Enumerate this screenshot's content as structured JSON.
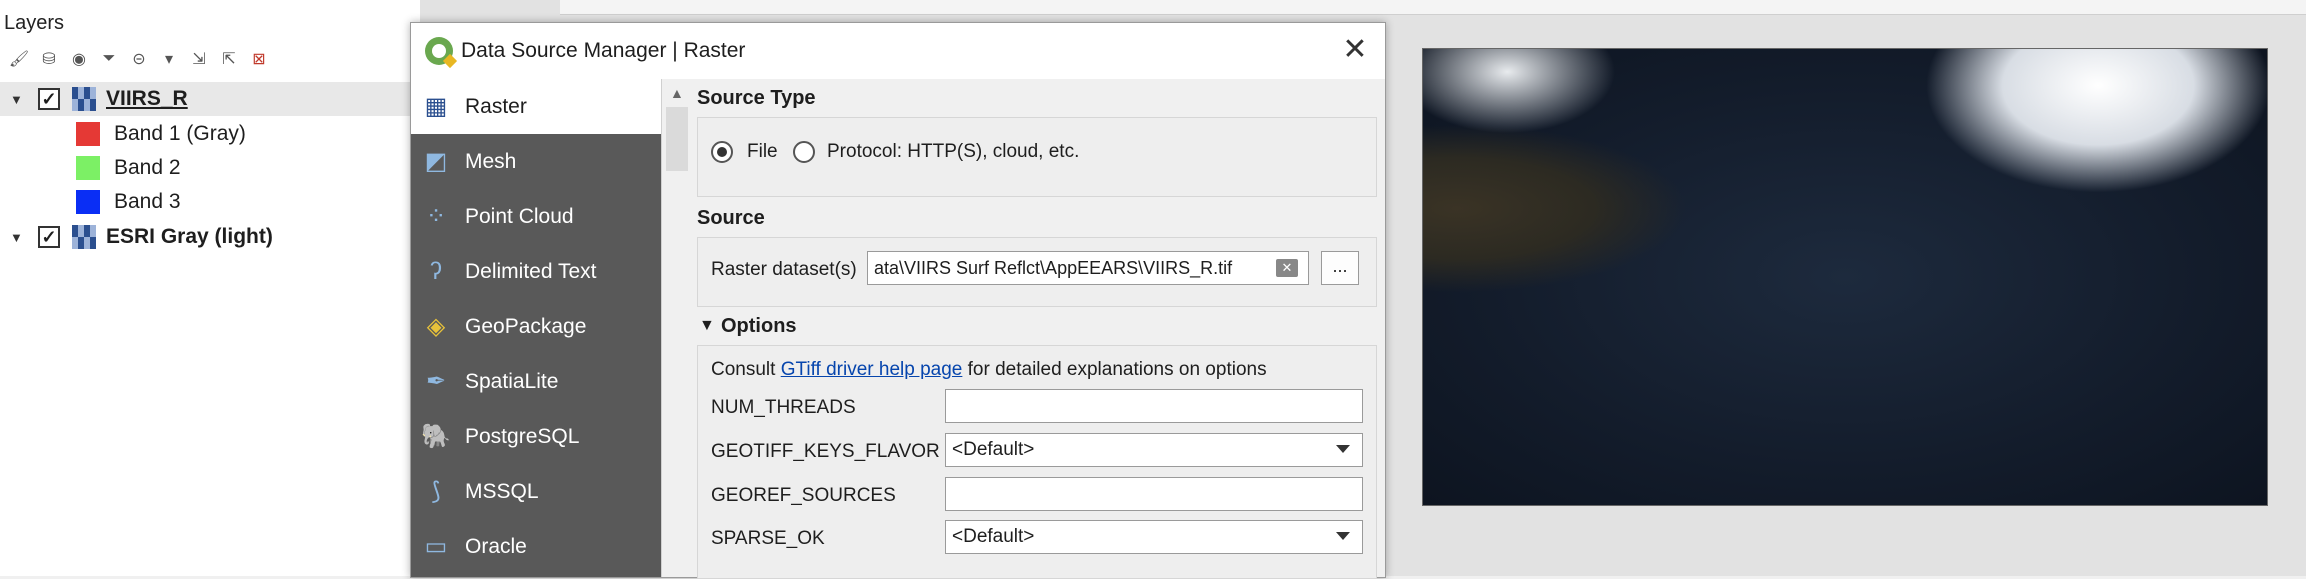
{
  "layers_panel": {
    "title": "Layers",
    "layers": [
      {
        "name": "VIIRS_R",
        "checked": true,
        "bands": [
          {
            "label": "Band 1 (Gray)",
            "color": "#e53935"
          },
          {
            "label": "Band 2",
            "color": "#7cf065"
          },
          {
            "label": "Band 3",
            "color": "#0a2ef5"
          }
        ]
      },
      {
        "name": "ESRI Gray (light)",
        "checked": true
      }
    ]
  },
  "dialog": {
    "title": "Data Source Manager | Raster",
    "sidebar": [
      {
        "label": "Raster",
        "icon": "raster-icon"
      },
      {
        "label": "Mesh",
        "icon": "mesh-icon"
      },
      {
        "label": "Point Cloud",
        "icon": "point-cloud-icon"
      },
      {
        "label": "Delimited Text",
        "icon": "delimited-text-icon"
      },
      {
        "label": "GeoPackage",
        "icon": "geopackage-icon"
      },
      {
        "label": "SpatiaLite",
        "icon": "spatialite-icon"
      },
      {
        "label": "PostgreSQL",
        "icon": "postgresql-icon"
      },
      {
        "label": "MSSQL",
        "icon": "mssql-icon"
      },
      {
        "label": "Oracle",
        "icon": "oracle-icon"
      }
    ],
    "source_type": {
      "title": "Source Type",
      "file_label": "File",
      "protocol_label": "Protocol: HTTP(S), cloud, etc."
    },
    "source": {
      "title": "Source",
      "dataset_label": "Raster dataset(s)",
      "dataset_value": "ata\\VIIRS Surf Reflct\\AppEEARS\\VIIRS_R.tif",
      "browse_label": "..."
    },
    "options": {
      "title": "Options",
      "consult_prefix": "Consult ",
      "link_text": "GTiff driver help page",
      "consult_suffix": " for detailed explanations on options",
      "rows": [
        {
          "label": "NUM_THREADS",
          "value": ""
        },
        {
          "label": "GEOTIFF_KEYS_FLAVOR",
          "value": "<Default>"
        },
        {
          "label": "GEOREF_SOURCES",
          "value": ""
        },
        {
          "label": "SPARSE_OK",
          "value": "<Default>"
        }
      ]
    }
  }
}
